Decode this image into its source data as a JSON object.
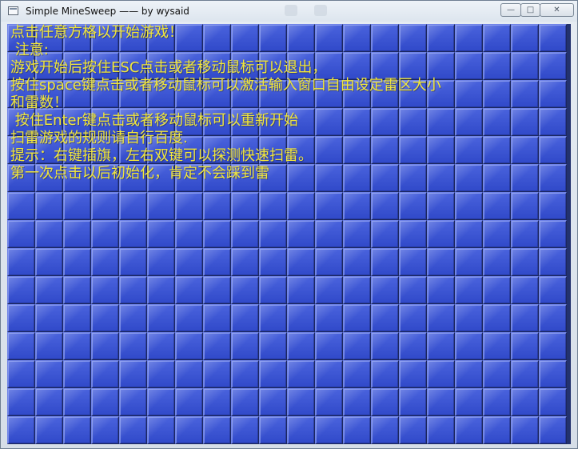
{
  "window": {
    "title": "Simple MineSweep —— by wysaid",
    "minimize_icon": "minimize-icon",
    "maximize_icon": "maximize-icon",
    "close_icon": "close-icon"
  },
  "board": {
    "columns": 20,
    "rows": 15,
    "tile_color": "#3d55d4",
    "text_color": "#f0e63c"
  },
  "intro": {
    "lines": [
      "点击任意方格以开始游戏！",
      " 注意:",
      "游戏开始后按住ESC点击或者移动鼠标可以退出，",
      "按住space键点击或者移动鼠标可以激活输入窗口自由设定雷区大小",
      "和雷数！",
      " 按住Enter键点击或者移动鼠标可以重新开始",
      "扫雷游戏的规则请自行百度.",
      "提示：右键插旗，左右双键可以探测快速扫雷。",
      "第一次点击以后初始化，肯定不会踩到雷"
    ]
  }
}
